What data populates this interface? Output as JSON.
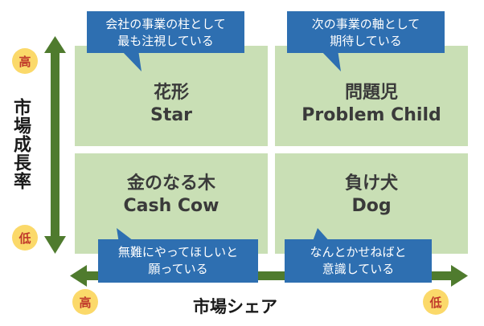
{
  "colors": {
    "quadrant_fill": "#c9dfb5",
    "callout_fill": "#2e6fb1",
    "arrow": "#4f7b2e",
    "circle_fill": "#fbd96a",
    "circle_text": "#c0392b"
  },
  "quadrants": {
    "star": {
      "jp": "花形",
      "en": "Star"
    },
    "problem_child": {
      "jp": "問題児",
      "en": "Problem Child"
    },
    "cash_cow": {
      "jp": "金のなる木",
      "en": "Cash Cow"
    },
    "dog": {
      "jp": "負け犬",
      "en": "Dog"
    }
  },
  "callouts": {
    "star": {
      "line1": "会社の事業の柱として",
      "line2": "最も注視している"
    },
    "problem_child": {
      "line1": "次の事業の軸として",
      "line2": "期待している"
    },
    "cash_cow": {
      "line1": "無難にやってほしいと",
      "line2": "願っている"
    },
    "dog": {
      "line1": "なんとかせねばと",
      "line2": "意識している"
    }
  },
  "axes": {
    "vertical": {
      "title": "市場成長率",
      "high": "高",
      "low": "低"
    },
    "horizontal": {
      "title": "市場シェア",
      "high": "高",
      "low": "低"
    }
  }
}
